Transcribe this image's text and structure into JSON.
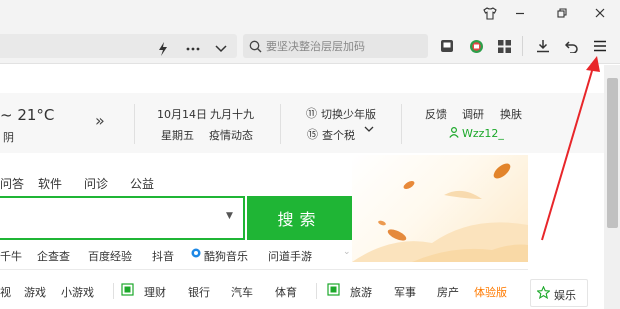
{
  "browser": {
    "search_placeholder": "要坚决整治层层加码"
  },
  "weather": {
    "temp": "~ 21°C",
    "condition": "阴"
  },
  "calendar": {
    "date": "10月14日",
    "lunar": "九月十九",
    "weekday": "星期五",
    "epidemic": "疫情动态"
  },
  "edition": {
    "switch_label": "切换少年版",
    "tax_label": "查个税"
  },
  "user_links": {
    "feedback": "反馈",
    "survey": "调研",
    "skin": "换肤",
    "username": "Wzz12_"
  },
  "search_tabs": [
    "问答",
    "软件",
    "问诊",
    "公益"
  ],
  "search_button": "搜索",
  "quick_links": [
    "千牛",
    "企查查",
    "百度经验",
    "抖音",
    "酷狗音乐",
    "问道手游"
  ],
  "categories_left": [
    "视",
    "游戏",
    "小游戏"
  ],
  "categories_mid": [
    "理财",
    "银行",
    "汽车",
    "体育"
  ],
  "categories_right": [
    "旅游",
    "军事",
    "房产"
  ],
  "experience_label": "体验版",
  "entertainment_label": "娱乐",
  "colors": {
    "accent_green": "#1fb535",
    "red_arrow": "#e8262a",
    "orange": "#ff7a00"
  }
}
